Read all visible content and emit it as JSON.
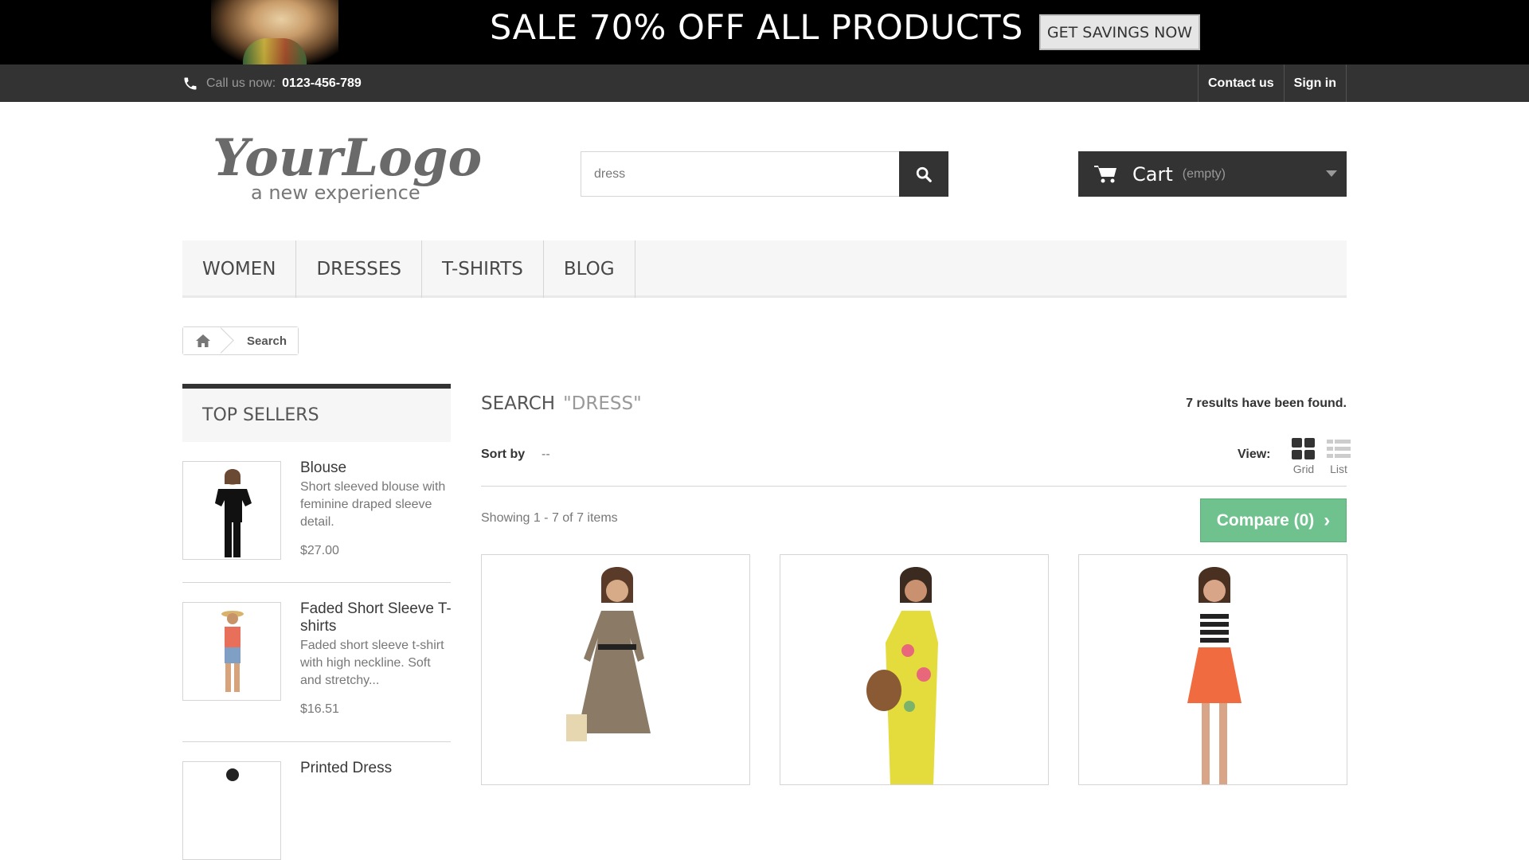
{
  "banner": {
    "text": "SALE 70% OFF ALL PRODUCTS",
    "cta": "GET SAVINGS NOW"
  },
  "topbar": {
    "call_label": "Call us now:",
    "phone": "0123-456-789",
    "contact": "Contact us",
    "signin": "Sign in"
  },
  "logo": {
    "main": "YourLogo",
    "tagline": "a new experience"
  },
  "search": {
    "value": "dress",
    "button_icon": "search-icon"
  },
  "cart": {
    "label": "Cart",
    "status": "(empty)"
  },
  "menu": {
    "items": [
      "WOMEN",
      "DRESSES",
      "T-SHIRTS",
      "BLOG"
    ]
  },
  "breadcrumb": {
    "current": "Search"
  },
  "sidebar": {
    "title": "TOP SELLERS",
    "products": [
      {
        "name": "Blouse",
        "desc": "Short sleeved blouse with feminine draped sleeve detail.",
        "price": "$27.00"
      },
      {
        "name": "Faded Short Sleeve T-shirts",
        "desc": "Faded short sleeve t-shirt with high neckline. Soft and stretchy...",
        "price": "$16.51"
      },
      {
        "name": "Printed Dress"
      }
    ]
  },
  "main": {
    "title": "SEARCH",
    "query": "\"DRESS\"",
    "results": "7 results have been found.",
    "sort_label": "Sort by",
    "sort_value": "--",
    "view_label": "View:",
    "view_grid": "Grid",
    "view_list": "List",
    "showing": "Showing 1 - 7 of 7 items",
    "compare": "Compare (0)"
  },
  "colors": {
    "dark": "#333333",
    "compare": "#6fc28d",
    "menu_bg": "#f6f6f6"
  }
}
